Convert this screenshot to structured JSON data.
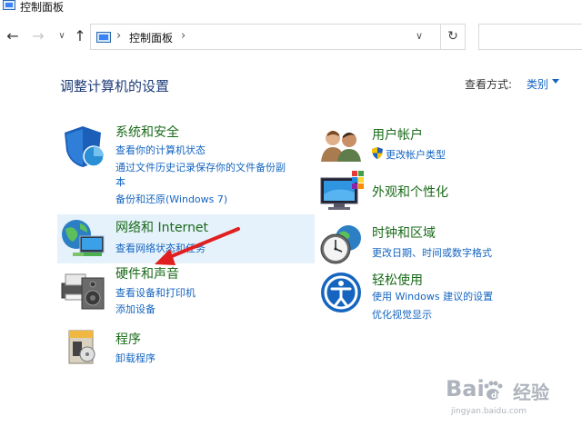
{
  "window": {
    "title": "控制面板",
    "icon": "control-panel-icon"
  },
  "nav": {
    "back_icon": "arrow-left-icon",
    "forward_icon": "arrow-right-icon",
    "recent_icon": "chevron-down-icon",
    "up_icon": "arrow-up-icon",
    "address_text": "控制面板",
    "refresh_icon": "refresh-icon",
    "search_placeholder": ""
  },
  "main": {
    "heading": "调整计算机的设置",
    "view_by_label": "查看方式:",
    "view_by_value": "类别"
  },
  "categories": {
    "system_security": {
      "title": "系统和安全",
      "icon": "shield-icon",
      "links": [
        "查看你的计算机状态",
        "通过文件历史记录保存你的文件备份副",
        "本",
        "备份和还原(Windows 7)"
      ]
    },
    "network": {
      "title": "网络和 Internet",
      "icon": "network-globe-icon",
      "links": [
        "查看网络状态和任务"
      ]
    },
    "hardware": {
      "title": "硬件和声音",
      "icon": "printer-speaker-icon",
      "links": [
        "查看设备和打印机",
        "添加设备"
      ]
    },
    "programs": {
      "title": "程序",
      "icon": "programs-box-icon",
      "links": [
        "卸载程序"
      ]
    },
    "user_accounts": {
      "title": "用户帐户",
      "icon": "users-icon",
      "links": [
        "更改帐户类型"
      ]
    },
    "appearance": {
      "title": "外观和个性化",
      "icon": "monitor-palette-icon",
      "links": []
    },
    "clock_region": {
      "title": "时钟和区域",
      "icon": "clock-globe-icon",
      "links": [
        "更改日期、时间或数字格式"
      ]
    },
    "ease_access": {
      "title": "轻松使用",
      "icon": "accessibility-icon",
      "links": [
        "使用 Windows 建议的设置",
        "优化视觉显示"
      ]
    }
  },
  "colors": {
    "category_title": "#1a6b1a",
    "link": "#1565c0",
    "heading": "#1e3b78",
    "hover": "#e5f1fb",
    "annotation_arrow": "#e02020"
  },
  "watermark": {
    "logo": "Baidu",
    "text": "经验",
    "url": "jingyan.baidu.com"
  }
}
